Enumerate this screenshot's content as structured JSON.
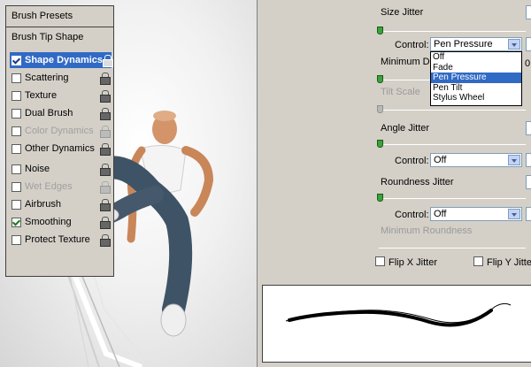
{
  "sidebar": {
    "presets_label": "Brush Presets",
    "tip_shape_label": "Brush Tip Shape",
    "items": [
      {
        "label": "Shape Dynamics",
        "checked": true,
        "selected": true,
        "disabled": false
      },
      {
        "label": "Scattering",
        "checked": false,
        "selected": false,
        "disabled": false
      },
      {
        "label": "Texture",
        "checked": false,
        "selected": false,
        "disabled": false
      },
      {
        "label": "Dual Brush",
        "checked": false,
        "selected": false,
        "disabled": false
      },
      {
        "label": "Color Dynamics",
        "checked": false,
        "selected": false,
        "disabled": true
      },
      {
        "label": "Other Dynamics",
        "checked": false,
        "selected": false,
        "disabled": false
      },
      {
        "label": "Noise",
        "checked": false,
        "selected": false,
        "disabled": false
      },
      {
        "label": "Wet Edges",
        "checked": false,
        "selected": false,
        "disabled": true
      },
      {
        "label": "Airbrush",
        "checked": false,
        "selected": false,
        "disabled": false
      },
      {
        "label": "Smoothing",
        "checked": true,
        "selected": false,
        "disabled": false
      },
      {
        "label": "Protect Texture",
        "checked": false,
        "selected": false,
        "disabled": false
      }
    ]
  },
  "shape": {
    "size_jitter_label": "Size Jitter",
    "control_label": "Control:",
    "size_control_value": "Pen Pressure",
    "min_diameter_label": "Minimum Dia",
    "min_diameter_value": "0",
    "tilt_scale_label": "Tilt Scale",
    "angle_jitter_label": "Angle Jitter",
    "angle_control_value": "Off",
    "roundness_jitter_label": "Roundness Jitter",
    "roundness_control_value": "Off",
    "min_roundness_label": "Minimum Roundness",
    "flip_x_label": "Flip X Jitter",
    "flip_y_label": "Flip Y Jitter"
  },
  "dropdown": {
    "options": [
      "Off",
      "Fade",
      "Pen Pressure",
      "Pen Tilt",
      "Stylus Wheel"
    ],
    "selected_index": 2
  }
}
